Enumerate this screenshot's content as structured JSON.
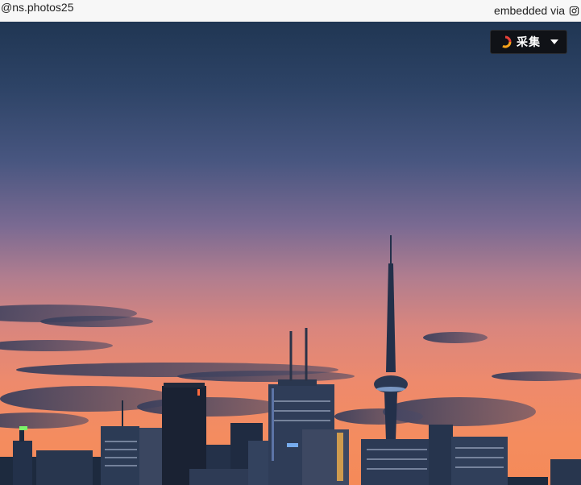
{
  "header": {
    "username": "@ns.photos25",
    "embed_label": "embedded via",
    "embed_icon": "instagram-icon"
  },
  "photo": {
    "subject": "city skyline at dusk"
  },
  "collect_button": {
    "label": "采集",
    "logo_icon": "huaban-logo-icon",
    "dropdown_icon": "caret-down-icon"
  },
  "colors": {
    "sky_top": "#203653",
    "sky_bottom": "#f58a58",
    "button_bg": "#101217"
  }
}
